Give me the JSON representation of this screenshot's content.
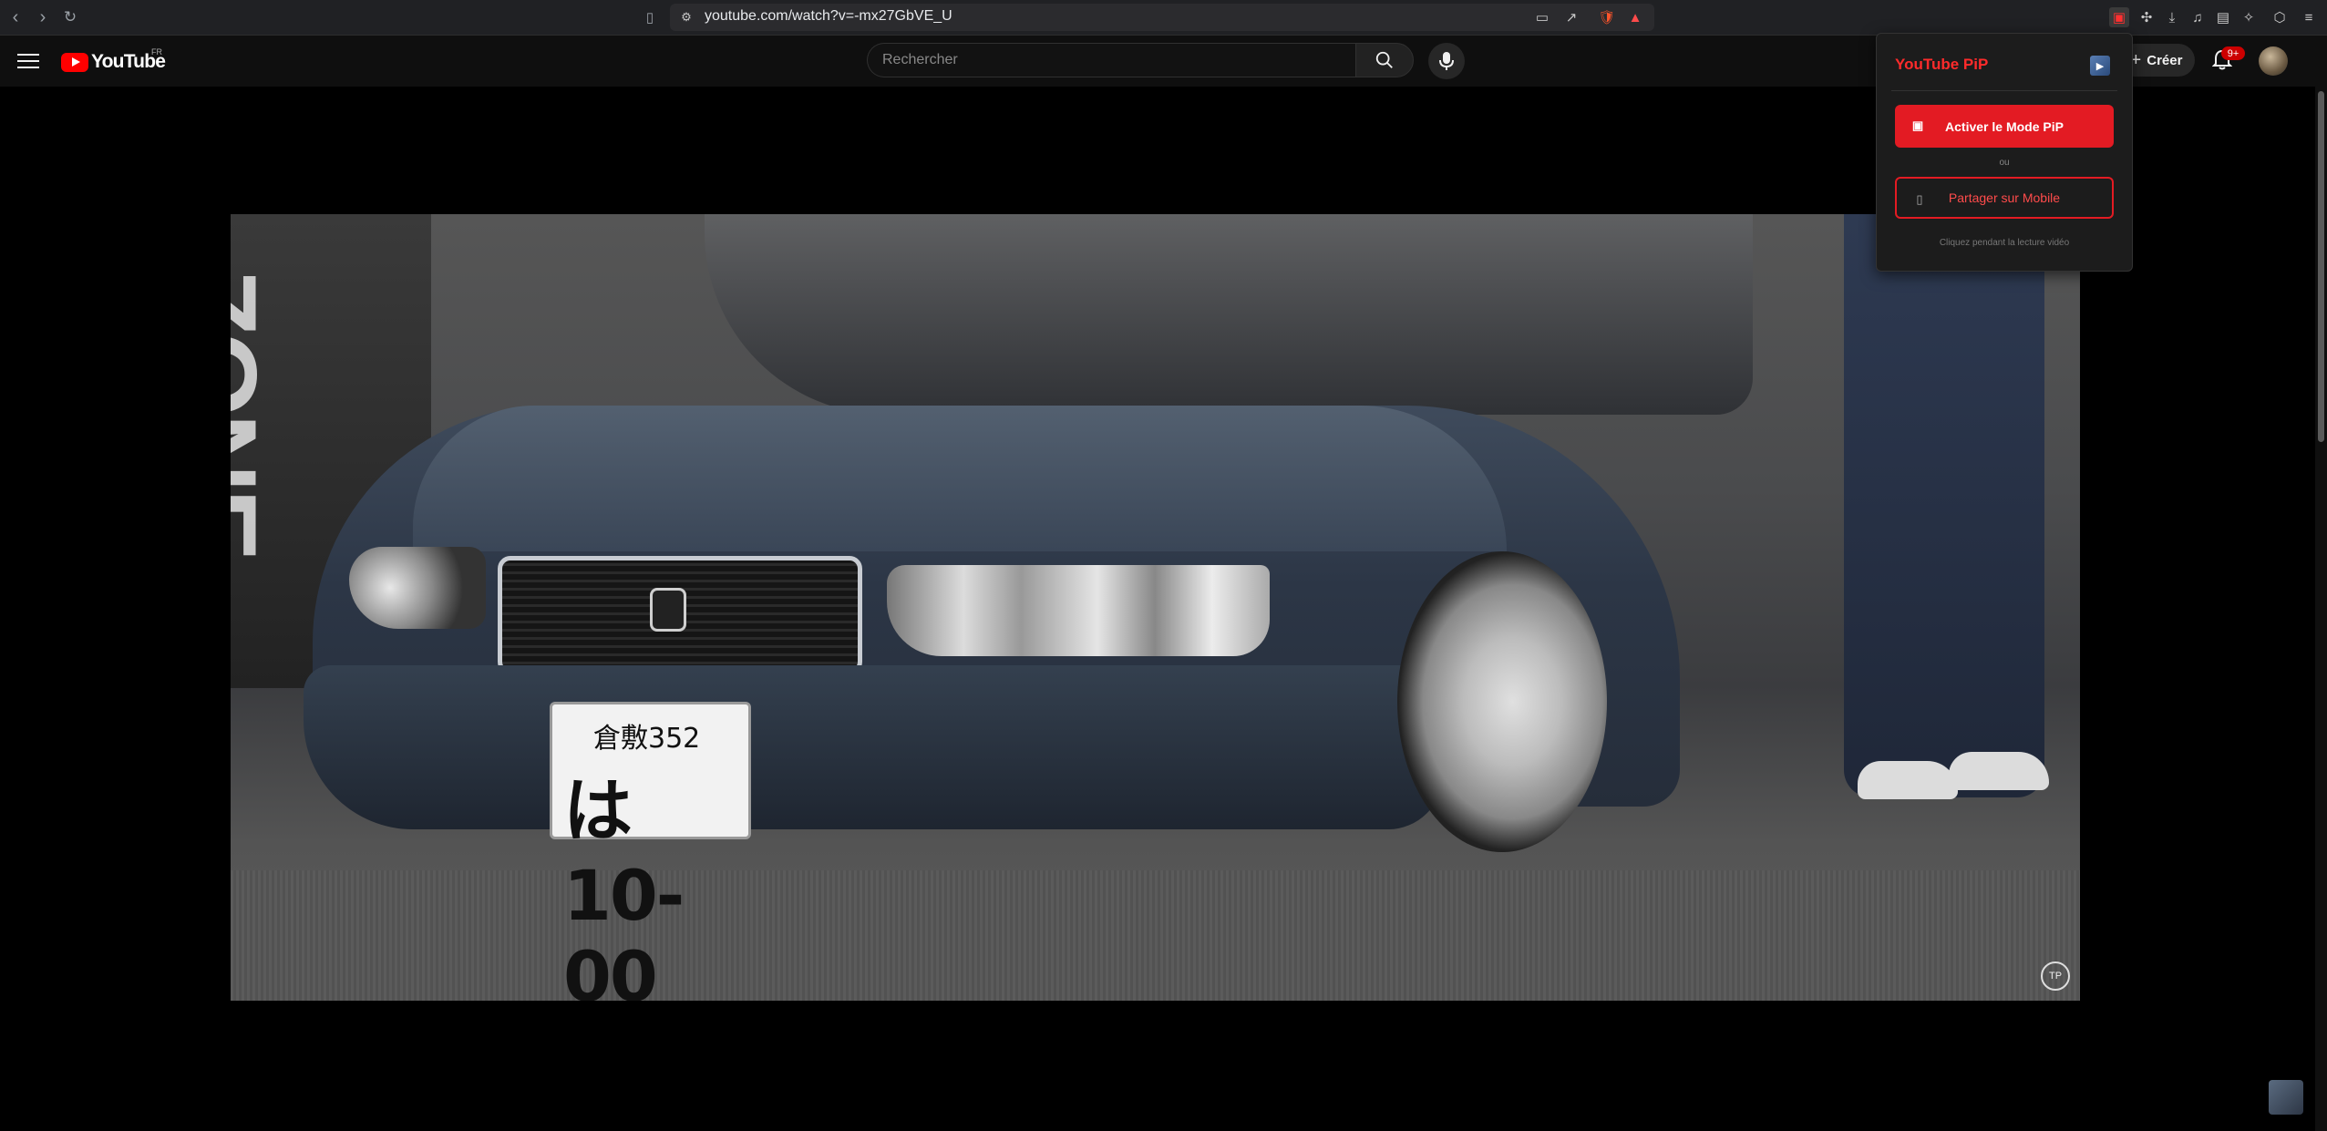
{
  "browser": {
    "url": "youtube.com/watch?v=-mx27GbVE_U",
    "icons": [
      "back-icon",
      "forward-icon",
      "reload-icon",
      "bookmark-icon",
      "cast-icon",
      "share-icon",
      "brave-shield-icon",
      "brave-rewards-icon",
      "youtube-pip-extension-icon",
      "extensions-icon",
      "downloads-icon",
      "media-icon",
      "wallet-icon",
      "leo-ai-icon",
      "vpn-icon",
      "menu-icon"
    ]
  },
  "youtube": {
    "logo_text": "YouTube",
    "country_code": "FR",
    "search_placeholder": "Rechercher",
    "create_label": "Créer",
    "notification_count": "9+"
  },
  "video": {
    "plate_top": "倉敷352",
    "plate_main": "は 10-00",
    "banner_text": "ZONE",
    "watermark": "TP"
  },
  "popup": {
    "title": "YouTube PiP",
    "activate_label": "Activer le Mode PiP",
    "or_label": "ou",
    "share_label": "Partager sur Mobile",
    "hint": "Cliquez pendant la lecture vidéo"
  },
  "colors": {
    "accent": "#e31b23",
    "title_red": "#ff2b2b",
    "page_bg": "#000000",
    "topbar_bg": "#0f0f0f"
  }
}
